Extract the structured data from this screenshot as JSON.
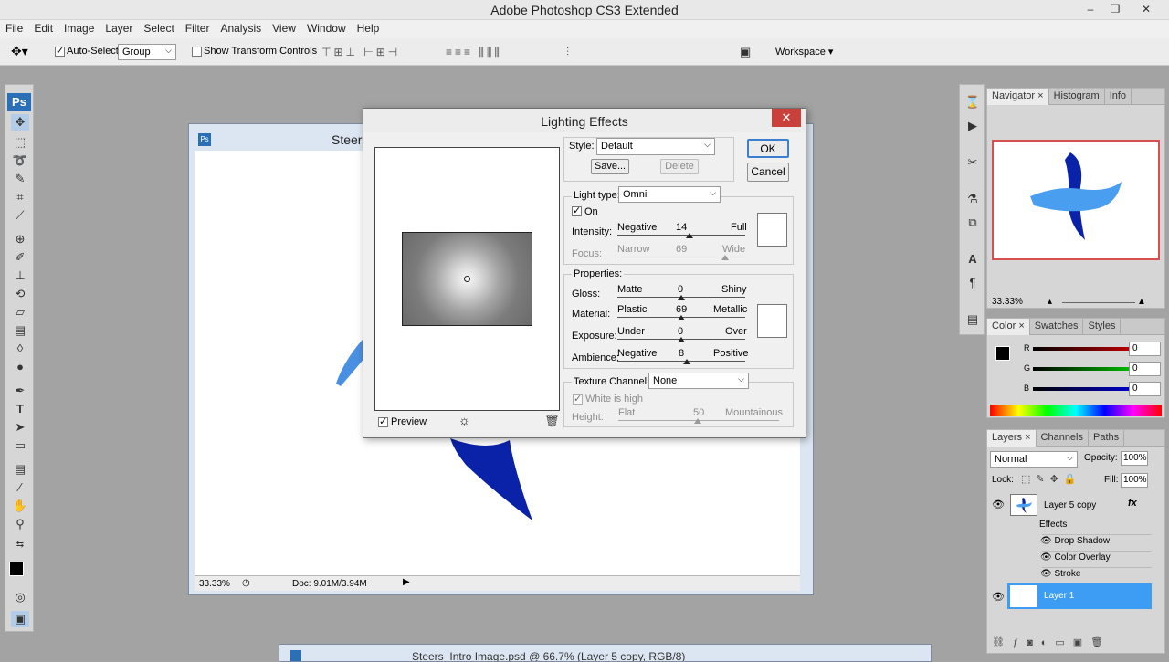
{
  "app": {
    "title": "Adobe Photoshop CS3 Extended",
    "window_buttons": [
      "–",
      "❐",
      "✕"
    ]
  },
  "menu": [
    "File",
    "Edit",
    "Image",
    "Layer",
    "Select",
    "Filter",
    "Analysis",
    "View",
    "Window",
    "Help"
  ],
  "options": {
    "auto_select_label": "Auto-Select:",
    "auto_select_checked": true,
    "auto_select_value": "Group",
    "show_transform_label": "Show Transform Controls",
    "workspace_label": "Workspace"
  },
  "document": {
    "title": "Steer",
    "zoom": "33.33%",
    "doc_size": "Doc: 9.01M/3.94M",
    "bottom_title": "Steers_Intro Image.psd @ 66.7% (Layer 5 copy, RGB/8)"
  },
  "dialog": {
    "title": "Lighting Effects",
    "close": "✕",
    "ok": "OK",
    "cancel": "Cancel",
    "style_label": "Style:",
    "style_value": "Default",
    "save_button": "Save...",
    "delete_button": "Delete",
    "light_type_label": "Light type:",
    "light_type_value": "Omni",
    "on_label": "On",
    "on_checked": true,
    "intensity": {
      "label": "Intensity:",
      "left": "Negative",
      "right": "Full",
      "value": "14"
    },
    "focus": {
      "label": "Focus:",
      "left": "Narrow",
      "right": "Wide",
      "value": "69"
    },
    "properties_label": "Properties:",
    "gloss": {
      "label": "Gloss:",
      "left": "Matte",
      "right": "Shiny",
      "value": "0"
    },
    "material": {
      "label": "Material:",
      "left": "Plastic",
      "right": "Metallic",
      "value": "69"
    },
    "exposure": {
      "label": "Exposure:",
      "left": "Under",
      "right": "Over",
      "value": "0"
    },
    "ambience": {
      "label": "Ambience:",
      "left": "Negative",
      "right": "Positive",
      "value": "8"
    },
    "texture_label": "Texture Channel:",
    "texture_value": "None",
    "white_high_label": "White is high",
    "height": {
      "label": "Height:",
      "left": "Flat",
      "right": "Mountainous",
      "value": "50"
    },
    "preview_label": "Preview",
    "preview_checked": true
  },
  "navigator": {
    "tabs": [
      "Navigator",
      "Histogram",
      "Info"
    ],
    "zoom": "33.33%"
  },
  "color_panel": {
    "tabs": [
      "Color",
      "Swatches",
      "Styles"
    ],
    "channels": [
      {
        "name": "R",
        "value": "0",
        "color": "#c00000"
      },
      {
        "name": "G",
        "value": "0",
        "color": "#00a000"
      },
      {
        "name": "B",
        "value": "0",
        "color": "#0000c8"
      }
    ]
  },
  "layers_panel": {
    "tabs": [
      "Layers",
      "Channels",
      "Paths"
    ],
    "blend_mode": "Normal",
    "opacity_label": "Opacity:",
    "opacity_value": "100%",
    "lock_label": "Lock:",
    "fill_label": "Fill:",
    "fill_value": "100%",
    "layers": [
      {
        "name": "Layer 5 copy",
        "effects_label": "Effects",
        "effects": [
          "Drop Shadow",
          "Color Overlay",
          "Stroke"
        ]
      },
      {
        "name": "Layer 1"
      }
    ]
  },
  "accent": {
    "selected": "#3d9df5",
    "shape_light": "#4a90e2",
    "shape_dark": "#0a22a8",
    "close_red": "#c9413a"
  }
}
